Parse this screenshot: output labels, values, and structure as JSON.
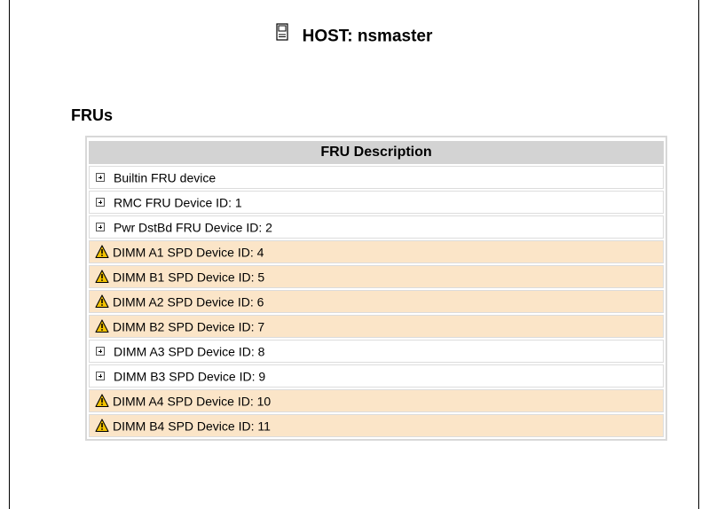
{
  "header": {
    "host_label": "HOST: nsmaster",
    "host_icon": "server-icon"
  },
  "section": {
    "title": "FRUs"
  },
  "table": {
    "column_header": "FRU Description",
    "rows": [
      {
        "label": "Builtin FRU device",
        "status": "ok",
        "icon": "expand-icon"
      },
      {
        "label": "RMC FRU Device ID: 1",
        "status": "ok",
        "icon": "expand-icon"
      },
      {
        "label": "Pwr DstBd FRU Device ID: 2",
        "status": "ok",
        "icon": "expand-icon"
      },
      {
        "label": "DIMM A1 SPD Device ID: 4",
        "status": "warning",
        "icon": "warning-icon"
      },
      {
        "label": "DIMM B1 SPD Device ID: 5",
        "status": "warning",
        "icon": "warning-icon"
      },
      {
        "label": "DIMM A2 SPD Device ID: 6",
        "status": "warning",
        "icon": "warning-icon"
      },
      {
        "label": "DIMM B2 SPD Device ID: 7",
        "status": "warning",
        "icon": "warning-icon"
      },
      {
        "label": "DIMM A3 SPD Device ID: 8",
        "status": "ok",
        "icon": "expand-icon"
      },
      {
        "label": "DIMM B3 SPD Device ID: 9",
        "status": "ok",
        "icon": "expand-icon"
      },
      {
        "label": "DIMM A4 SPD Device ID: 10",
        "status": "warning",
        "icon": "warning-icon"
      },
      {
        "label": "DIMM B4 SPD Device ID: 11",
        "status": "warning",
        "icon": "warning-icon"
      }
    ]
  },
  "colors": {
    "warning_row_bg": "#fbe5c8",
    "header_bg": "#d3d3d3",
    "warning_icon": "#f2c200"
  }
}
